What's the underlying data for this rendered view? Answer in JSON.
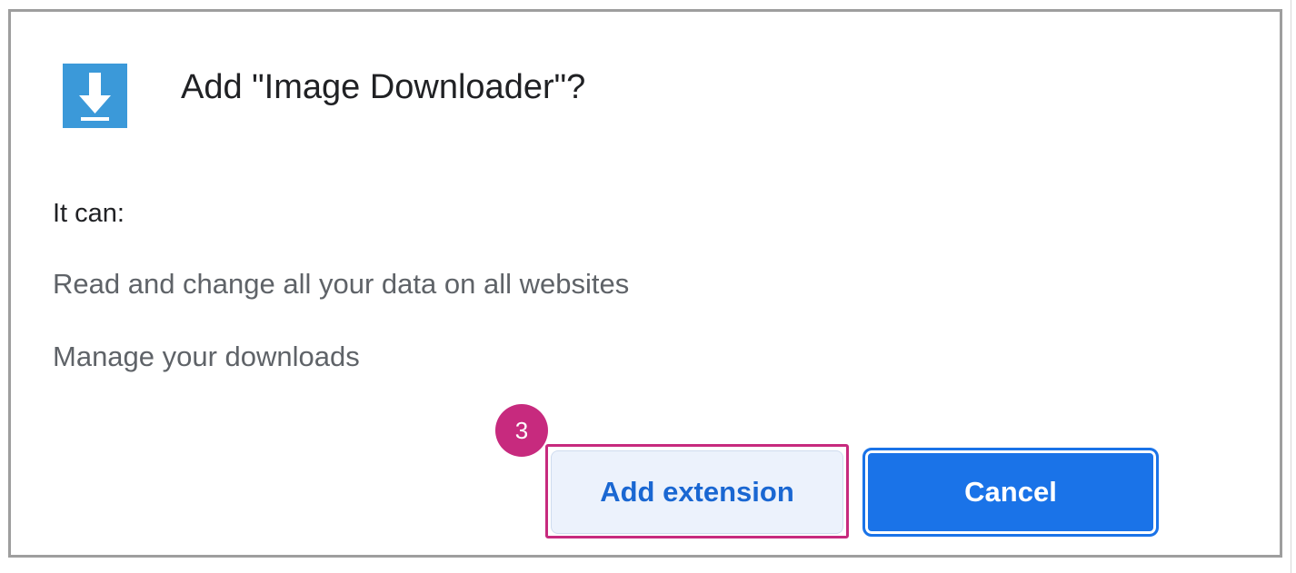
{
  "dialog": {
    "title": "Add \"Image Downloader\"?",
    "icon": "download-arrow-icon",
    "it_can": "It can:",
    "permissions": [
      "Read and change all your data on all websites",
      "Manage your downloads"
    ],
    "add_label": "Add extension",
    "cancel_label": "Cancel"
  },
  "annotation": {
    "step": "3"
  },
  "colors": {
    "icon_blue": "#3b99d9",
    "primary": "#1a73e8",
    "add_bg": "#ecf2fc",
    "add_text": "#1a67d2",
    "annotation": "#c72a7e"
  }
}
